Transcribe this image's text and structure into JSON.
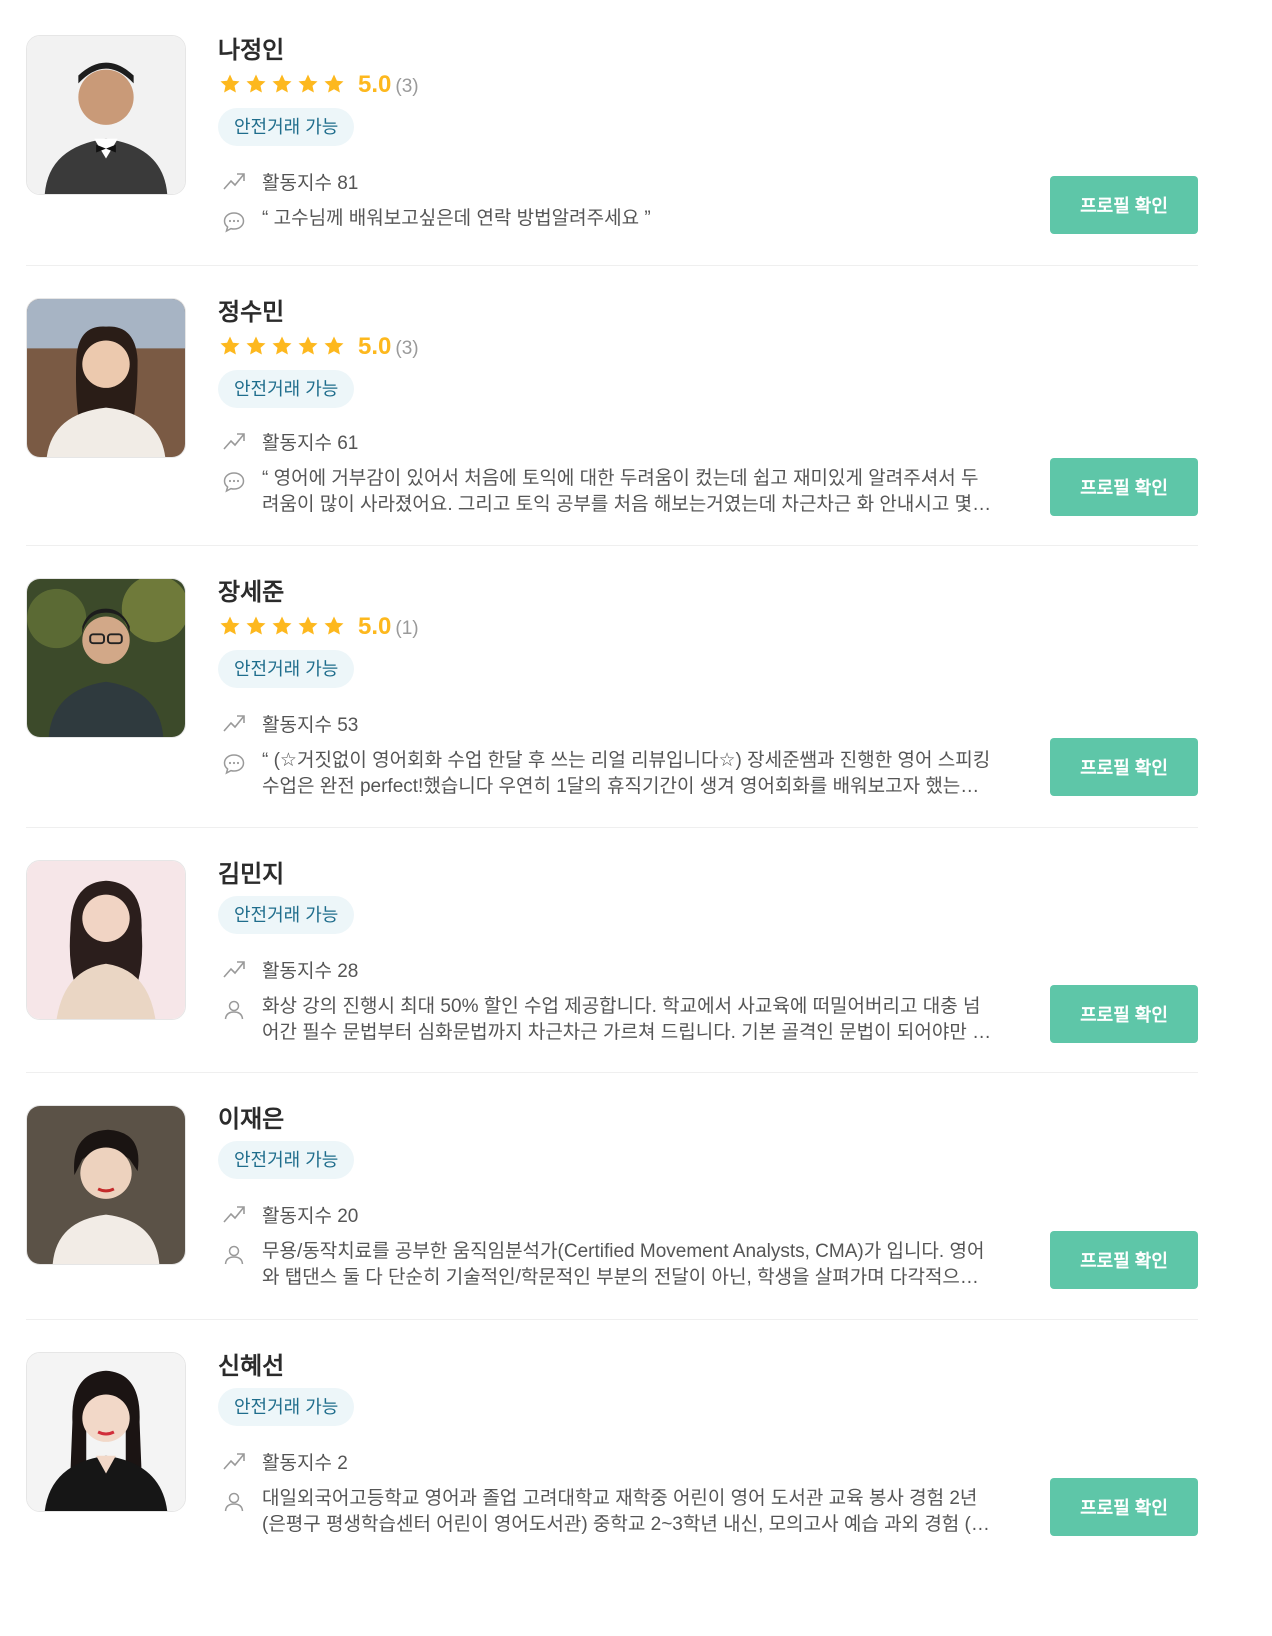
{
  "colors": {
    "accent": "#5ec6a8",
    "star": "#fdb81e",
    "badge_bg": "#edf6f9",
    "badge_text": "#1f6d8c"
  },
  "profiles": [
    {
      "name": "나정인",
      "score": "5.0",
      "count": "(3)",
      "badge": "안전거래 가능",
      "activity": "활동지수 81",
      "text_icon": "speech-bubble-icon",
      "text": "“ 고수님께 배워보고싶은데 연락 방법알려주세요 ”",
      "button": "프로필 확인",
      "rating": 5
    },
    {
      "name": "정수민",
      "score": "5.0",
      "count": "(3)",
      "badge": "안전거래 가능",
      "activity": "활동지수 61",
      "text_icon": "speech-bubble-icon",
      "text": "“ 영어에 거부감이 있어서 처음에 토익에 대한 두려움이 컸는데 쉽고 재미있게 알려주셔서 두려움이 많이 사라졌어요. 그리고 토익 공부를 처음 해보는거였는데 차근차근 화 안내시고 몇번이고 …",
      "button": "프로필 확인",
      "rating": 5
    },
    {
      "name": "장세준",
      "score": "5.0",
      "count": "(1)",
      "badge": "안전거래 가능",
      "activity": "활동지수 53",
      "text_icon": "speech-bubble-icon",
      "text": "“ (☆거짓없이 영어회화 수업 한달 후 쓰는 리얼 리뷰입니다☆) 장세준쌤과 진행한 영어 스피킹 수업은 완전 perfect!했습니다 우연히 1달의 휴직기간이 생겨 영어회화를 배워보고자 했는데 정…",
      "button": "프로필 확인",
      "rating": 5
    },
    {
      "name": "김민지",
      "badge": "안전거래 가능",
      "activity": "활동지수 28",
      "text_icon": "person-icon",
      "text": "화상 강의 진행시 최대 50% 할인 수업 제공합니다. 학교에서 사교육에 떠밀어버리고 대충 넘어간 필수 문법부터 심화문법까지 차근차근 가르쳐 드립니다. 기본 골격인 문법이 되어야만 제대로 …",
      "button": "프로필 확인"
    },
    {
      "name": "이재은",
      "badge": "안전거래 가능",
      "activity": "활동지수 20",
      "text_icon": "person-icon",
      "text": "무용/동작치료를 공부한 움직임분석가(Certified Movement Analysts, CMA)가 입니다. 영어와 탭댄스 둘 다 단순히 기술적인/학문적인 부분의 전달이 아닌, 학생을 살펴가며 다각적으로 접근…",
      "button": "프로필 확인"
    },
    {
      "name": "신혜선",
      "badge": "안전거래 가능",
      "activity": "활동지수 2",
      "text_icon": "person-icon",
      "text": "대일외국어고등학교 영어과 졸업 고려대학교 재학중 어린이 영어 도서관 교육 봉사 경험 2년(은평구 평생학습센터 어린이 영어도서관) 중학교 2~3학년 내신, 모의고사 예습 과외 경험 (70점대 -…",
      "button": "프로필 확인"
    }
  ]
}
